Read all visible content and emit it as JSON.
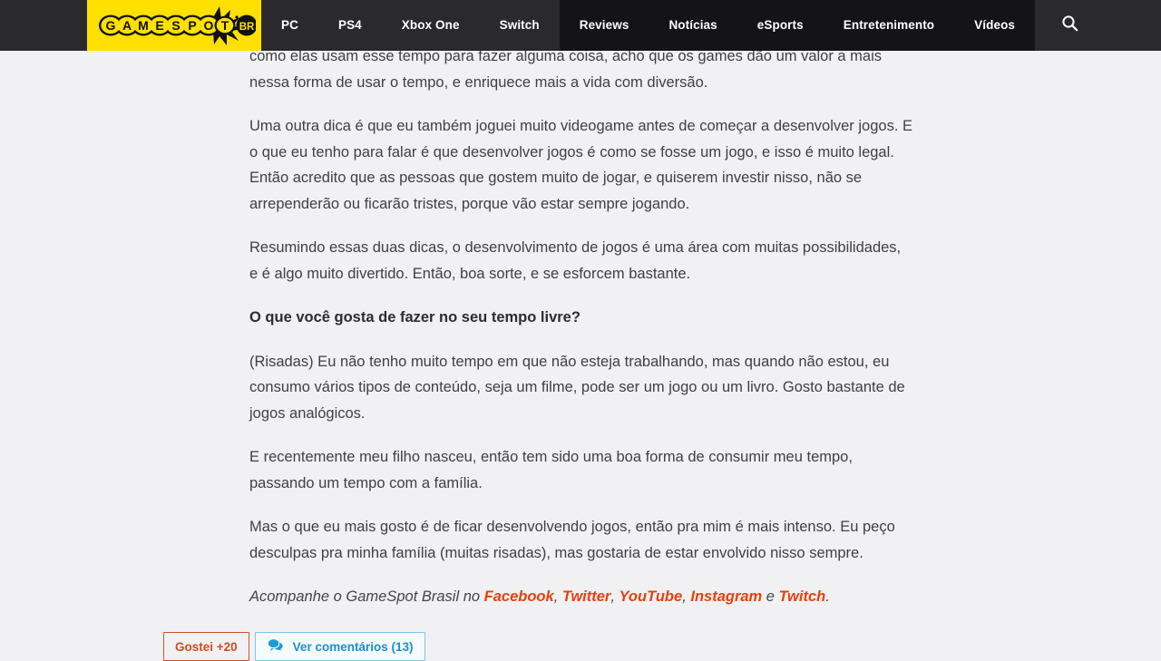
{
  "site": {
    "brand_name": "GAMESPOT",
    "brand_region": "BR",
    "logo_bg_color": "#ffe000",
    "header_bg_color": "#2a2a2e",
    "nav_bg_color": "#141417"
  },
  "nav": {
    "platform_items": [
      {
        "label": "PC",
        "name": "nav-pc"
      },
      {
        "label": "PS4",
        "name": "nav-ps4"
      },
      {
        "label": "Xbox One",
        "name": "nav-xbox-one"
      },
      {
        "label": "Switch",
        "name": "nav-switch"
      }
    ],
    "editorial_items": [
      {
        "label": "Reviews",
        "name": "nav-reviews"
      },
      {
        "label": "Notícias",
        "name": "nav-noticias"
      },
      {
        "label": "eSports",
        "name": "nav-esports"
      },
      {
        "label": "Entretenimento",
        "name": "nav-entretenimento"
      },
      {
        "label": "Vídeos",
        "name": "nav-videos"
      }
    ],
    "search_icon": "search-icon"
  },
  "article": {
    "paragraphs": [
      "como elas usam esse tempo para fazer alguma coisa, acho que os games dão um valor a mais nessa forma de usar o tempo, e enriquece mais a vida com diversão.",
      "Uma outra dica é que eu também joguei muito videogame antes de começar a desenvolver jogos. E o que eu tenho para falar é que desenvolver jogos é como se fosse um jogo, e isso é muito legal. Então acredito que as pessoas que gostem muito de jogar, e quiserem investir nisso, não se arrependerão ou ficarão tristes, porque vão estar sempre jogando.",
      "Resumindo essas duas dicas, o desenvolvimento de jogos é uma área com muitas possibilidades, e é algo muito divertido. Então, boa sorte, e se esforcem bastante."
    ],
    "question_heading": "O que você gosta de fazer no seu tempo livre?",
    "answer_paragraphs": [
      "(Risadas) Eu não tenho muito tempo em que não esteja trabalhando, mas quando não estou, eu consumo vários tipos de conteúdo, seja um filme, pode ser um jogo ou um livro. Gosto bastante de jogos analógicos.",
      "E recentemente meu filho nasceu, então tem sido uma boa forma de consumir meu tempo, passando um tempo com a família.",
      "Mas o que eu mais gosto é de ficar desenvolvendo jogos, então pra mim é mais intenso. Eu peço desculpas pra minha família (muitas risadas), mas gostaria de estar envolvido nisso sempre."
    ],
    "follow": {
      "prefix": "Acompanhe o GameSpot Brasil no ",
      "links": [
        {
          "label": "Facebook",
          "after": ", "
        },
        {
          "label": "Twitter",
          "after": ", "
        },
        {
          "label": "YouTube",
          "after": ", "
        },
        {
          "label": "Instagram",
          "after": " e "
        },
        {
          "label": "Twitch",
          "after": "."
        }
      ],
      "link_color": "#e8400a"
    }
  },
  "actions": {
    "like_label": "Gostei +20",
    "comments_label": "Ver comentários (13)",
    "comments_icon": "comments-bubble-icon",
    "like_color": "#d6491c",
    "comments_color": "#1b8fd1"
  }
}
